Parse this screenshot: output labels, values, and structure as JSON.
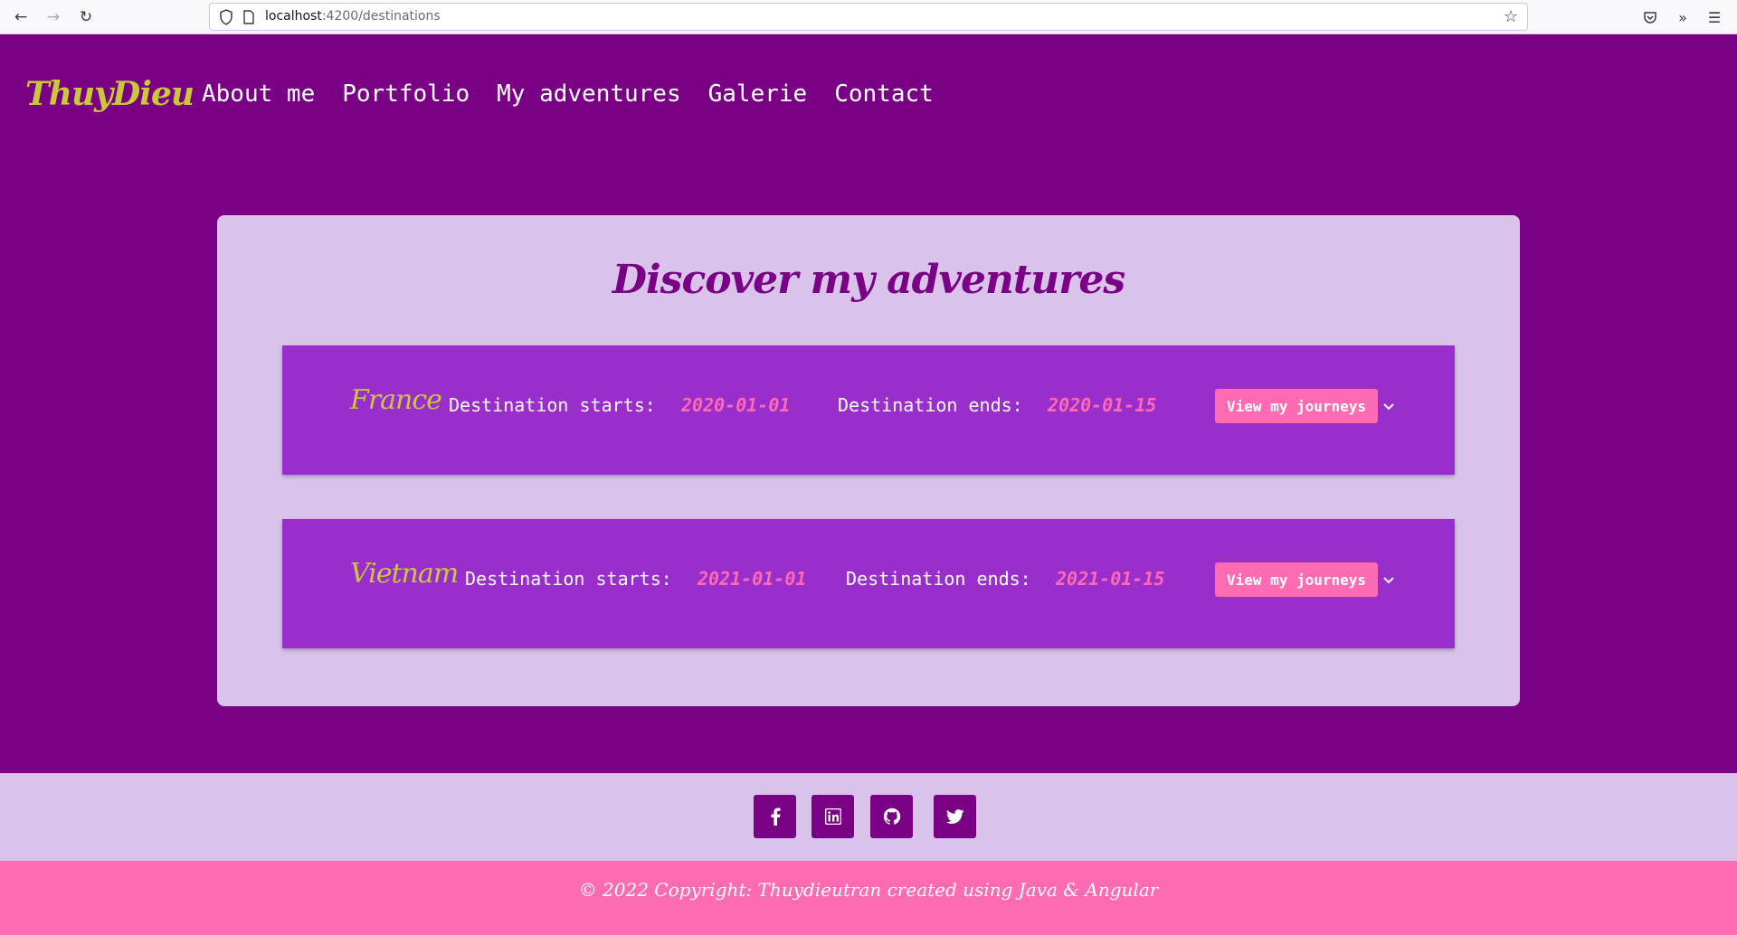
{
  "browser": {
    "url_host": "localhost",
    "url_rest": ":4200/destinations"
  },
  "header": {
    "logo": "ThuyDieu",
    "nav": [
      "About me",
      "Portfolio",
      "My adventures",
      "Galerie",
      "Contact"
    ]
  },
  "main": {
    "title": "Discover my adventures",
    "destinations": [
      {
        "name": "France",
        "starts_label": "Destination starts:",
        "start_date": "2020-01-01",
        "ends_label": "Destination ends:",
        "end_date": "2020-01-15",
        "button": "View my journeys"
      },
      {
        "name": "Vietnam",
        "starts_label": "Destination starts:",
        "start_date": "2021-01-01",
        "ends_label": "Destination ends:",
        "end_date": "2021-01-15",
        "button": "View my journeys"
      }
    ]
  },
  "footer": {
    "social": [
      "facebook-icon",
      "linkedin-icon",
      "github-icon",
      "twitter-icon"
    ],
    "copyright": "© 2022 Copyright: Thuydieutran created using Java & Angular"
  },
  "colors": {
    "background": "#7a0086",
    "card": "#d9c3ea",
    "destination": "#9a2ecc",
    "accent_pink": "#ff6bb2",
    "logo_yellow": "#c8c83a"
  }
}
